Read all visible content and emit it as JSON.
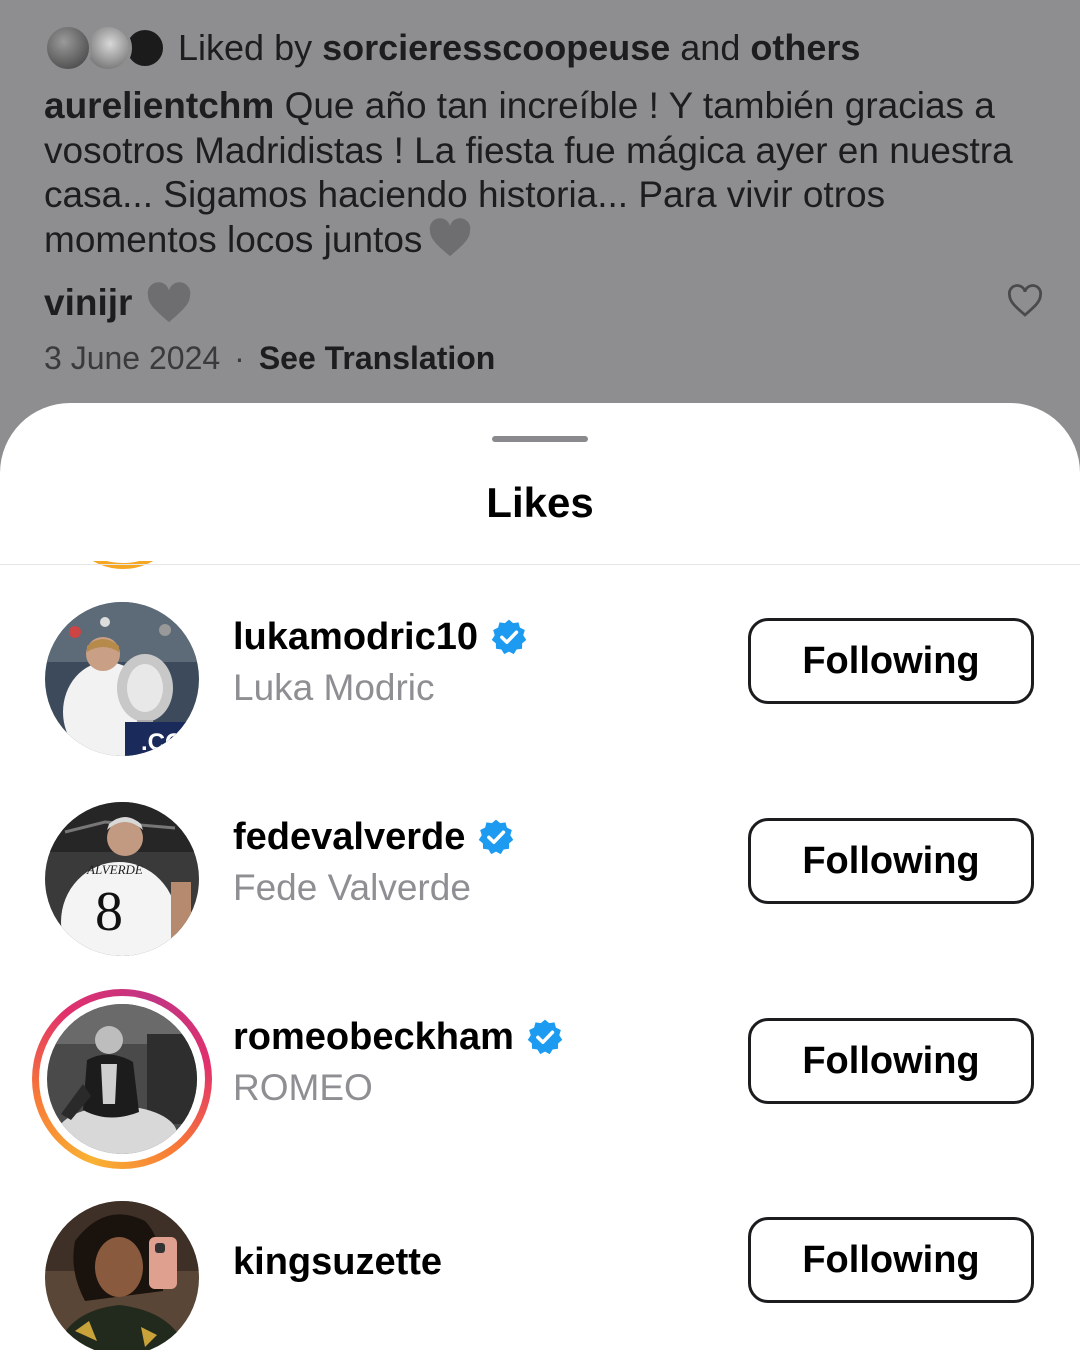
{
  "post": {
    "liked_by_prefix": "Liked by ",
    "liked_by_user": "sorcieresscoopeuse",
    "liked_by_and": " and ",
    "liked_by_others": "others",
    "caption_user": "aurelientchm",
    "caption_text": " Que año tan increíble ! Y también gracias a vosotros Madridistas ! La fiesta fue mágica ayer en nuestra casa... Sigamos haciendo historia... Para vivir otros momentos locos juntos",
    "comment_user": "vinijr",
    "date": "3 June 2024",
    "separator": "·",
    "see_translation": "See Translation"
  },
  "sheet": {
    "title": "Likes",
    "users": [
      {
        "username": "lukamodric10",
        "full_name": "Luka Modric",
        "verified": true,
        "story_ring": false,
        "button": "Following"
      },
      {
        "username": "fedevalverde",
        "full_name": "Fede Valverde",
        "verified": true,
        "story_ring": false,
        "button": "Following"
      },
      {
        "username": "romeobeckham",
        "full_name": "ROMEO",
        "verified": true,
        "story_ring": true,
        "button": "Following"
      },
      {
        "username": "kingsuzette",
        "full_name": "",
        "verified": false,
        "story_ring": false,
        "button": "Following"
      }
    ]
  },
  "colors": {
    "verified_blue": "#1d9bf0",
    "dim_overlay": "#8e8e90",
    "heart_emoji_grey": "#6e6e70"
  },
  "icons": [
    "grey-heart-emoji-icon",
    "heart-outline-icon",
    "verified-badge-icon"
  ]
}
